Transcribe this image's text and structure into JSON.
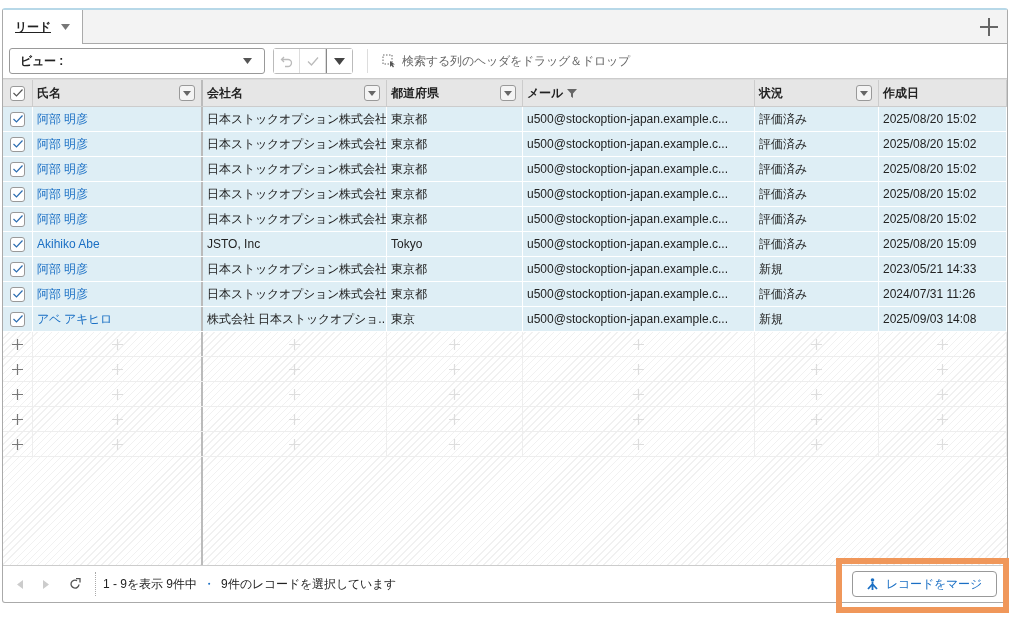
{
  "tabs": [
    {
      "label": "リード",
      "selected": true
    }
  ],
  "toolbar": {
    "view_select": {
      "label": "ビュー :"
    },
    "undo_disabled": true,
    "save_disabled": true,
    "hint": "検索する列のヘッダをドラッグ＆ドロップ"
  },
  "table": {
    "all_checked": true,
    "columns": [
      {
        "label": "氏名",
        "kind": "menu"
      },
      {
        "label": "会社名",
        "kind": "menu"
      },
      {
        "label": "都道府県",
        "kind": "menu"
      },
      {
        "label": "メール",
        "kind": "filter"
      },
      {
        "label": "状況",
        "kind": "menu"
      },
      {
        "label": "作成日",
        "kind": "plain"
      }
    ],
    "rows": [
      {
        "checked": true,
        "cells": [
          "阿部 明彦",
          "日本ストックオプション株式会社",
          "東京都",
          "u500@stockoption-japan.example.c...",
          "評価済み",
          "2025/08/20 15:02"
        ]
      },
      {
        "checked": true,
        "cells": [
          "阿部 明彦",
          "日本ストックオプション株式会社",
          "東京都",
          "u500@stockoption-japan.example.c...",
          "評価済み",
          "2025/08/20 15:02"
        ]
      },
      {
        "checked": true,
        "cells": [
          "阿部 明彦",
          "日本ストックオプション株式会社",
          "東京都",
          "u500@stockoption-japan.example.c...",
          "評価済み",
          "2025/08/20 15:02"
        ]
      },
      {
        "checked": true,
        "cells": [
          "阿部 明彦",
          "日本ストックオプション株式会社",
          "東京都",
          "u500@stockoption-japan.example.c...",
          "評価済み",
          "2025/08/20 15:02"
        ]
      },
      {
        "checked": true,
        "cells": [
          "阿部 明彦",
          "日本ストックオプション株式会社",
          "東京都",
          "u500@stockoption-japan.example.c...",
          "評価済み",
          "2025/08/20 15:02"
        ]
      },
      {
        "checked": true,
        "cells": [
          "Akihiko Abe",
          "JSTO, Inc",
          "Tokyo",
          "u500@stockoption-japan.example.c...",
          "評価済み",
          "2025/08/20 15:09"
        ]
      },
      {
        "checked": true,
        "cells": [
          "阿部 明彦",
          "日本ストックオプション株式会社",
          "東京都",
          "u500@stockoption-japan.example.c...",
          "新規",
          "2023/05/21 14:33"
        ]
      },
      {
        "checked": true,
        "cells": [
          "阿部 明彦",
          "日本ストックオプション株式会社",
          "東京都",
          "u500@stockoption-japan.example.c...",
          "評価済み",
          "2024/07/31 11:26"
        ]
      },
      {
        "checked": true,
        "cells": [
          "アベ アキヒロ",
          "株式会社 日本ストックオプショ...",
          "東京",
          "u500@stockoption-japan.example.c...",
          "新規",
          "2025/09/03 14:08"
        ]
      }
    ]
  },
  "footer": {
    "prev_disabled": true,
    "next_disabled": true,
    "range": "1 - 9を表示 9件中",
    "separator": "・",
    "selection": "9件のレコードを選択しています",
    "merge_button": {
      "label": "レコードをマージ",
      "highlighted": true
    }
  }
}
